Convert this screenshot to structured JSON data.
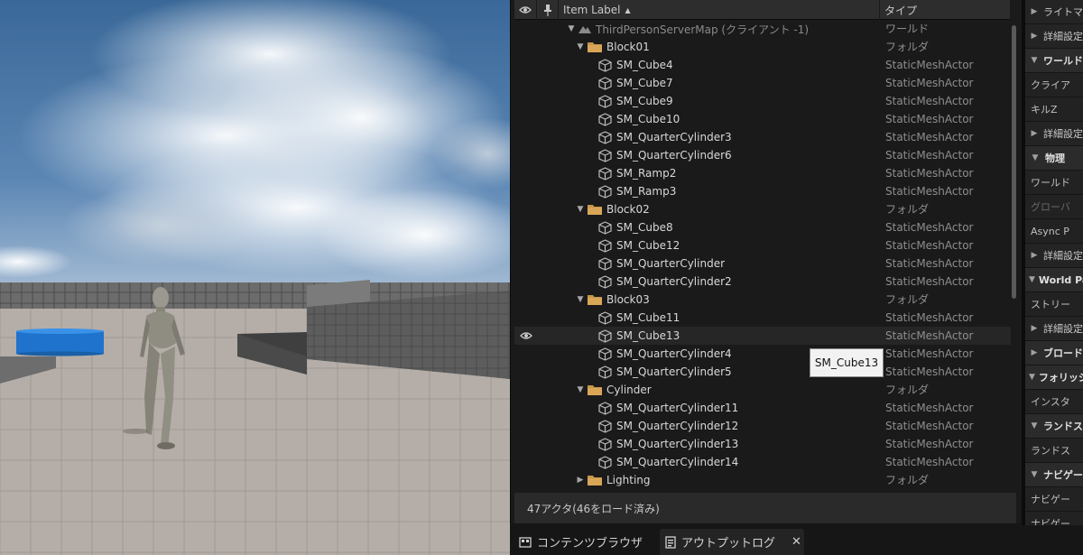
{
  "outliner": {
    "columns": {
      "label": "Item Label",
      "type": "タイプ"
    },
    "rows": [
      {
        "label": "ThirdPersonServerMap (クライアント -1)",
        "type": "ワールド",
        "kind": "world",
        "depth": 0,
        "expanded": true
      },
      {
        "label": "Block01",
        "type": "フォルダ",
        "kind": "folder",
        "depth": 1,
        "expanded": true
      },
      {
        "label": "SM_Cube4",
        "type": "StaticMeshActor",
        "kind": "mesh",
        "depth": 2
      },
      {
        "label": "SM_Cube7",
        "type": "StaticMeshActor",
        "kind": "mesh",
        "depth": 2
      },
      {
        "label": "SM_Cube9",
        "type": "StaticMeshActor",
        "kind": "mesh",
        "depth": 2
      },
      {
        "label": "SM_Cube10",
        "type": "StaticMeshActor",
        "kind": "mesh",
        "depth": 2
      },
      {
        "label": "SM_QuarterCylinder3",
        "type": "StaticMeshActor",
        "kind": "mesh",
        "depth": 2
      },
      {
        "label": "SM_QuarterCylinder6",
        "type": "StaticMeshActor",
        "kind": "mesh",
        "depth": 2
      },
      {
        "label": "SM_Ramp2",
        "type": "StaticMeshActor",
        "kind": "mesh",
        "depth": 2
      },
      {
        "label": "SM_Ramp3",
        "type": "StaticMeshActor",
        "kind": "mesh",
        "depth": 2
      },
      {
        "label": "Block02",
        "type": "フォルダ",
        "kind": "folder",
        "depth": 1,
        "expanded": true
      },
      {
        "label": "SM_Cube8",
        "type": "StaticMeshActor",
        "kind": "mesh",
        "depth": 2
      },
      {
        "label": "SM_Cube12",
        "type": "StaticMeshActor",
        "kind": "mesh",
        "depth": 2
      },
      {
        "label": "SM_QuarterCylinder",
        "type": "StaticMeshActor",
        "kind": "mesh",
        "depth": 2
      },
      {
        "label": "SM_QuarterCylinder2",
        "type": "StaticMeshActor",
        "kind": "mesh",
        "depth": 2
      },
      {
        "label": "Block03",
        "type": "フォルダ",
        "kind": "folder",
        "depth": 1,
        "expanded": true
      },
      {
        "label": "SM_Cube11",
        "type": "StaticMeshActor",
        "kind": "mesh",
        "depth": 2
      },
      {
        "label": "SM_Cube13",
        "type": "StaticMeshActor",
        "kind": "mesh",
        "depth": 2,
        "hovered": true
      },
      {
        "label": "SM_QuarterCylinder4",
        "type": "StaticMeshActor",
        "kind": "mesh",
        "depth": 2
      },
      {
        "label": "SM_QuarterCylinder5",
        "type": "StaticMeshActor",
        "kind": "mesh",
        "depth": 2
      },
      {
        "label": "Cylinder",
        "type": "フォルダ",
        "kind": "folder",
        "depth": 1,
        "expanded": true
      },
      {
        "label": "SM_QuarterCylinder11",
        "type": "StaticMeshActor",
        "kind": "mesh",
        "depth": 2
      },
      {
        "label": "SM_QuarterCylinder12",
        "type": "StaticMeshActor",
        "kind": "mesh",
        "depth": 2
      },
      {
        "label": "SM_QuarterCylinder13",
        "type": "StaticMeshActor",
        "kind": "mesh",
        "depth": 2
      },
      {
        "label": "SM_QuarterCylinder14",
        "type": "StaticMeshActor",
        "kind": "mesh",
        "depth": 2
      },
      {
        "label": "Lighting",
        "type": "フォルダ",
        "kind": "folder",
        "depth": 1,
        "expanded": false
      }
    ],
    "tooltip": "SM_Cube13",
    "status": "47アクタ(46をロード済み)"
  },
  "bottom_tabs": {
    "content_browser": "コンテンツブラウザ",
    "output_log": "アウトプットログ",
    "close": "✕"
  },
  "details": {
    "rows": [
      {
        "label": "ライトマ",
        "kind": "collapsed"
      },
      {
        "label": "詳細設定",
        "kind": "collapsed"
      },
      {
        "label": "ワールド",
        "kind": "section"
      },
      {
        "label": "クライア",
        "kind": "sub"
      },
      {
        "label": "キルZ",
        "kind": "sub"
      },
      {
        "label": "詳細設定",
        "kind": "collapsed"
      },
      {
        "label": "物理",
        "kind": "section"
      },
      {
        "label": "ワールド",
        "kind": "sub"
      },
      {
        "label": "グローバ",
        "kind": "sub-dim"
      },
      {
        "label": "Async P",
        "kind": "sub"
      },
      {
        "label": "詳細設定",
        "kind": "collapsed"
      },
      {
        "label": "World Pa",
        "kind": "section"
      },
      {
        "label": "ストリー",
        "kind": "sub"
      },
      {
        "label": "詳細設定",
        "kind": "collapsed"
      },
      {
        "label": "ブロード",
        "kind": "section-collapsed"
      },
      {
        "label": "フォリッジ",
        "kind": "section"
      },
      {
        "label": "インスタ",
        "kind": "sub"
      },
      {
        "label": "ランドス",
        "kind": "section"
      },
      {
        "label": "ランドス",
        "kind": "sub"
      },
      {
        "label": "ナビゲー",
        "kind": "section"
      },
      {
        "label": "ナビゲー",
        "kind": "sub"
      },
      {
        "label": "ナビゲー",
        "kind": "sub"
      }
    ]
  },
  "colors": {
    "sky_top": "#3f6e9e",
    "ground": "#b3aca6",
    "wall": "#5e5e5e",
    "cylinder": "#1e78d2",
    "folder": "#c8964a"
  }
}
